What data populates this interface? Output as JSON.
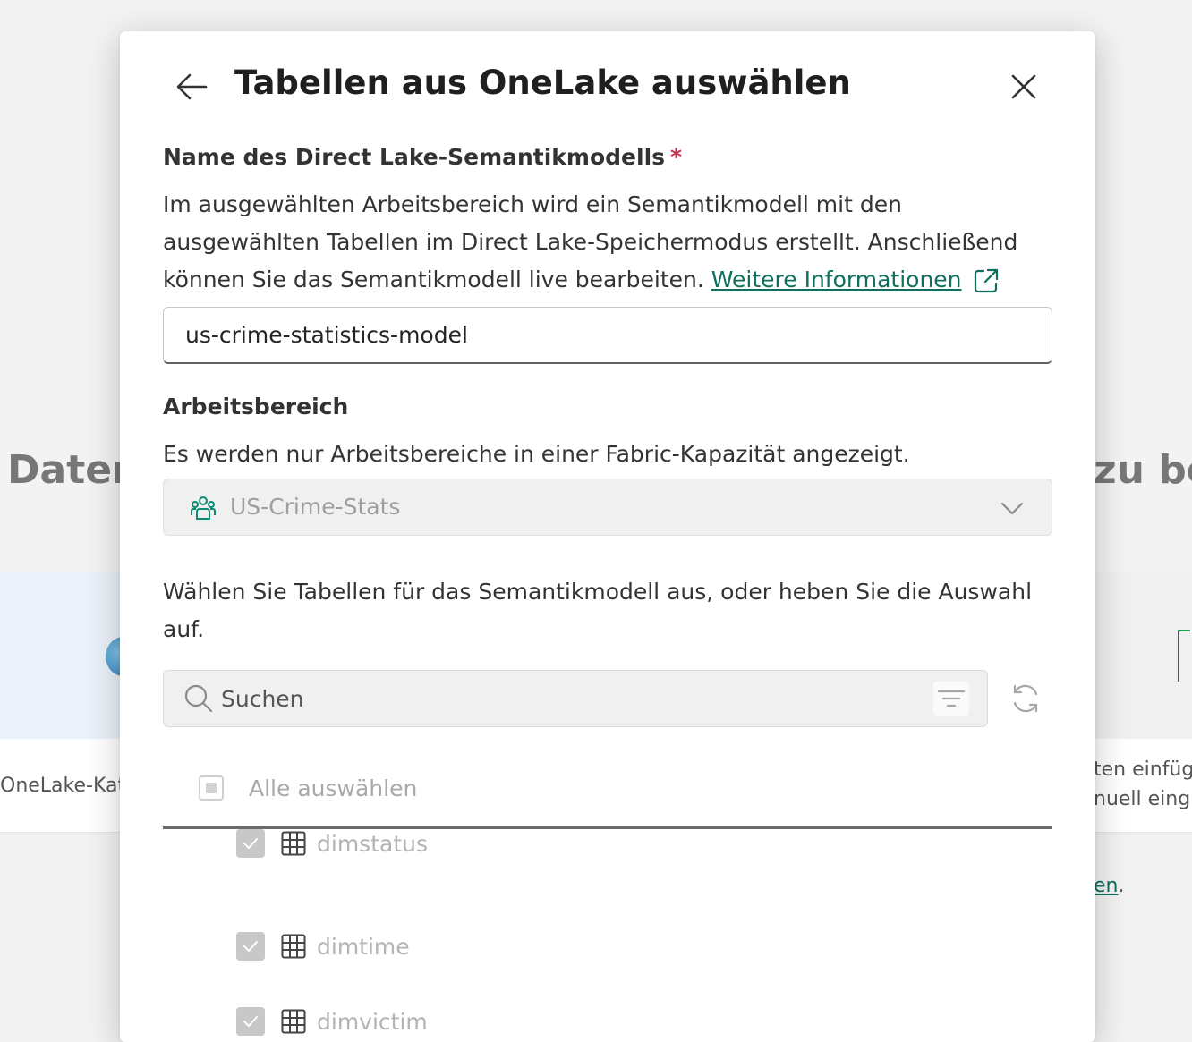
{
  "background": {
    "left_heading": "Daten",
    "right_heading": "zu be",
    "left_card_label": "OneLake-Kat",
    "right_card_line1": "ten einfüg",
    "right_card_line2": "nuell eing",
    "right_link": "en",
    "right_link_suffix": "."
  },
  "dialog": {
    "title": "Tabellen aus OneLake auswählen",
    "model_name": {
      "label": "Name des Direct Lake-Semantikmodells",
      "required_marker": "*",
      "description": "Im ausgewählten Arbeitsbereich wird ein Semantikmodell mit den ausgewählten Tabellen im Direct Lake-Speichermodus erstellt. Anschließend können Sie das Semantikmodell live bearbeiten.",
      "link_text": "Weitere Informationen",
      "value": "us-crime-statistics-model"
    },
    "workspace": {
      "label": "Arbeitsbereich",
      "description": "Es werden nur Arbeitsbereiche in einer Fabric-Kapazität angezeigt.",
      "selected": "US-Crime-Stats"
    },
    "tables": {
      "instruction": "Wählen Sie Tabellen für das Semantikmodell aus, oder heben Sie die Auswahl auf.",
      "search_placeholder": "Suchen",
      "select_all_label": "Alle auswählen",
      "items": [
        {
          "name": "dimstatus",
          "checked": true
        },
        {
          "name": "dimtime",
          "checked": true
        },
        {
          "name": "dimvictim",
          "checked": true
        }
      ]
    }
  },
  "colors": {
    "accent": "#0f6f5c",
    "required": "#c4314b",
    "disabled_text": "#9e9e9e"
  }
}
